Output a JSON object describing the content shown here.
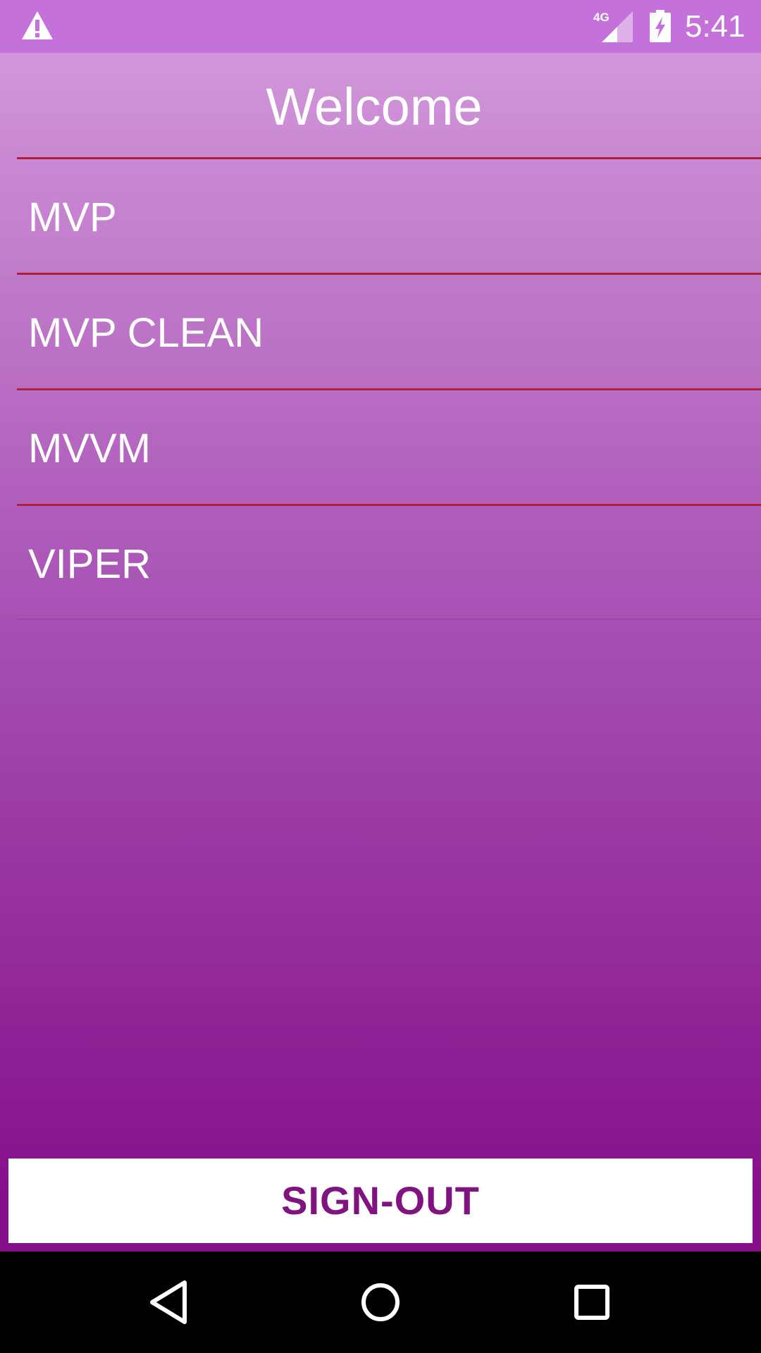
{
  "status_bar": {
    "time": "5:41",
    "network_label": "4G",
    "background_color": "#c471db",
    "icons": [
      "warning-icon",
      "signal-icon",
      "battery-charging-icon"
    ]
  },
  "header": {
    "title": "Welcome"
  },
  "architecture_list": {
    "items": [
      {
        "label": "MVP"
      },
      {
        "label": "MVP CLEAN"
      },
      {
        "label": "MVVM"
      },
      {
        "label": "VIPER"
      }
    ],
    "divider_color": "#b11f3e"
  },
  "sign_out_button": {
    "label": "SIGN-OUT",
    "text_color": "#80137f"
  },
  "theme": {
    "gradient_top": "#d196d9",
    "gradient_bottom": "#840f89"
  },
  "nav_bar": {
    "icons": [
      "back-icon",
      "home-icon",
      "recent-apps-icon"
    ]
  }
}
